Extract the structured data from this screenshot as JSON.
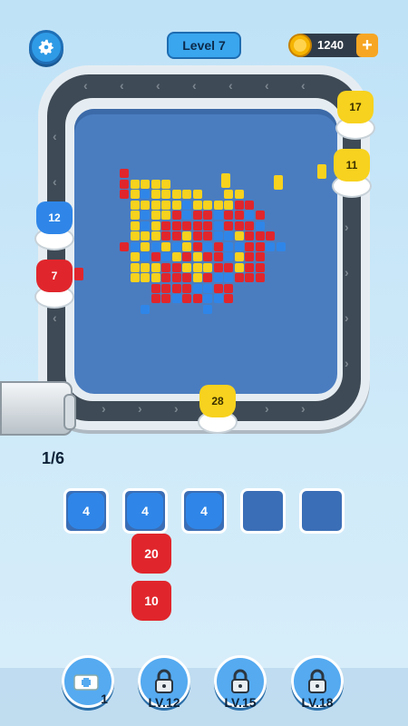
{
  "header": {
    "level_label": "Level 7",
    "coins": "1240",
    "plus": "+"
  },
  "track_shooters": [
    {
      "count": "17",
      "color": "yellow"
    },
    {
      "count": "11",
      "color": "yellow"
    },
    {
      "count": "12",
      "color": "blue"
    },
    {
      "count": "7",
      "color": "red"
    },
    {
      "count": "28",
      "color": "yellow"
    }
  ],
  "progress": {
    "text": "1/6"
  },
  "slots": [
    {
      "count": "4",
      "color": "blue"
    },
    {
      "count": "4",
      "color": "blue"
    },
    {
      "count": "4",
      "color": "blue"
    },
    {
      "count": "",
      "color": "empty"
    },
    {
      "count": "",
      "color": "empty"
    }
  ],
  "queue": [
    {
      "count": "20",
      "color": "red"
    },
    {
      "count": "10",
      "color": "red"
    }
  ],
  "boosters": [
    {
      "name": "add-slot",
      "count": "1"
    },
    {
      "name": "locked",
      "label": "LV.12"
    },
    {
      "name": "locked",
      "label": "LV.15"
    },
    {
      "name": "locked",
      "label": "LV.18"
    }
  ],
  "colors": {
    "yellow": "#f7d21e",
    "blue": "#2f86e8",
    "red": "#e0262c"
  }
}
